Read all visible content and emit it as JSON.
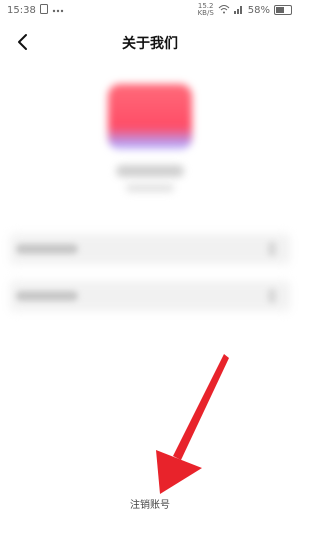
{
  "status": {
    "time": "15:38",
    "net_speed": "15.2",
    "net_unit": "KB/S",
    "battery": "58%"
  },
  "header": {
    "title": "关于我们",
    "back_icon": "chevron-left-icon"
  },
  "footer": {
    "cancel_account": "注销账号"
  },
  "colors": {
    "arrow": "#e8232b",
    "logo_top": "#ff6a79",
    "logo_bottom": "#b79bf2"
  }
}
